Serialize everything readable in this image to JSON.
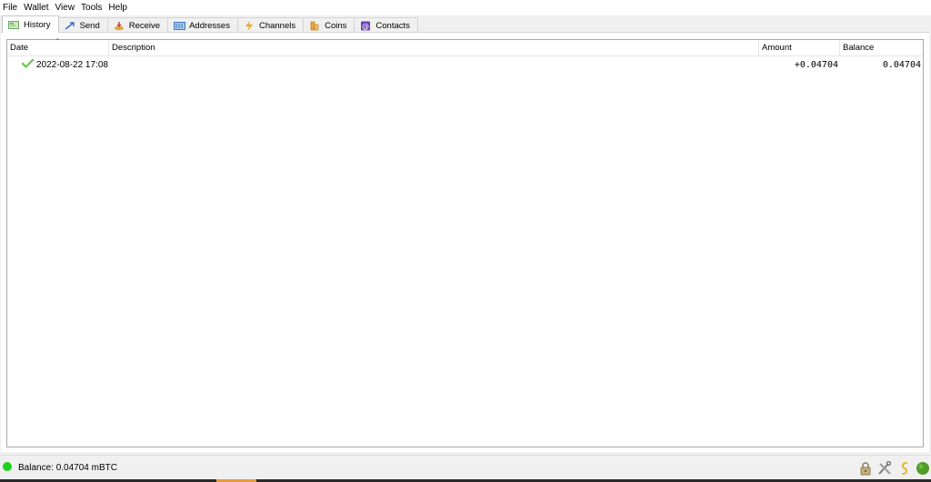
{
  "menu": {
    "items": [
      "File",
      "Wallet",
      "View",
      "Tools",
      "Help"
    ]
  },
  "tabs": [
    {
      "label": "History",
      "icon": "history-icon",
      "active": true
    },
    {
      "label": "Send",
      "icon": "send-icon",
      "active": false
    },
    {
      "label": "Receive",
      "icon": "receive-icon",
      "active": false
    },
    {
      "label": "Addresses",
      "icon": "addresses-icon",
      "active": false
    },
    {
      "label": "Channels",
      "icon": "lightning-icon",
      "active": false
    },
    {
      "label": "Coins",
      "icon": "coins-icon",
      "active": false
    },
    {
      "label": "Contacts",
      "icon": "contacts-icon",
      "active": false
    }
  ],
  "history": {
    "columns": {
      "date": "Date",
      "description": "Description",
      "amount": "Amount",
      "balance": "Balance"
    },
    "rows": [
      {
        "status_icon": "confirmed-check-icon",
        "date": "2022-08-22 17:08",
        "description": "",
        "amount": "+0.04704",
        "balance": "0.04704"
      }
    ]
  },
  "status": {
    "balance_text": "Balance: 0.04704 mBTC",
    "connection_color": "#1fd11f",
    "icons": [
      "lock-icon",
      "tools-icon",
      "seed-icon",
      "network-status-icon"
    ]
  }
}
